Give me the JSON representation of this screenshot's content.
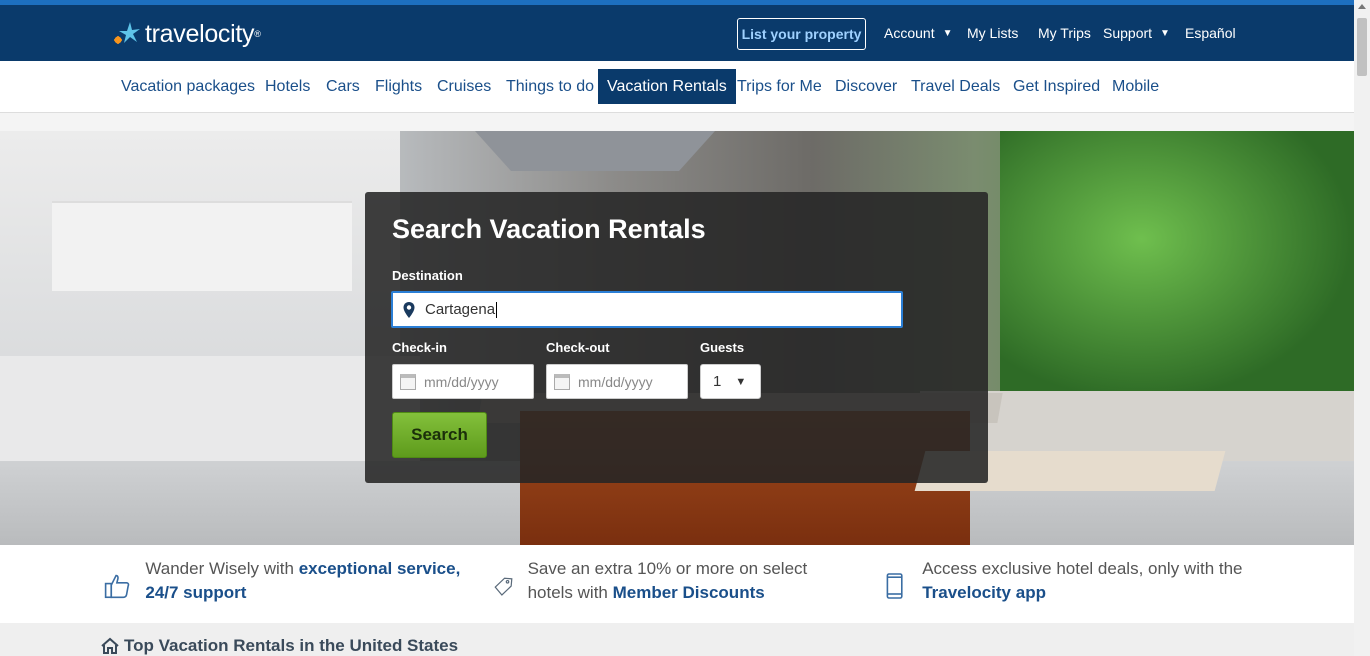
{
  "brand": {
    "name": "travelocity",
    "tm": "®"
  },
  "header": {
    "list_property": "List your property",
    "links": [
      "Account",
      "My Lists",
      "My Trips",
      "Support",
      "Español"
    ]
  },
  "nav": {
    "items": [
      "Vacation packages",
      "Hotels",
      "Cars",
      "Flights",
      "Cruises",
      "Things to do",
      "Vacation Rentals",
      "Trips for Me",
      "Discover",
      "Travel Deals",
      "Get Inspired",
      "Mobile"
    ],
    "active": "Vacation Rentals"
  },
  "search": {
    "title": "Search Vacation Rentals",
    "destination_label": "Destination",
    "destination_value": "Cartagena",
    "checkin_label": "Check-in",
    "checkin_placeholder": "mm/dd/yyyy",
    "checkout_label": "Check-out",
    "checkout_placeholder": "mm/dd/yyyy",
    "guests_label": "Guests",
    "guests_value": "1",
    "button": "Search"
  },
  "benefits": [
    {
      "icon": "thumbs-up-icon",
      "text": "Wander Wisely with ",
      "bold": "exceptional service, 24/7 support"
    },
    {
      "icon": "tag-icon",
      "text": "Save an extra 10% or more on select hotels with ",
      "bold": "Member Discounts"
    },
    {
      "icon": "phone-icon",
      "text": "Access exclusive hotel deals, only with the ",
      "bold": "Travelocity app"
    }
  ],
  "section": {
    "title": "Top Vacation Rentals in the United States",
    "icon": "home-icon"
  },
  "colors": {
    "header": "#0a3a6b",
    "accent": "#2b7fd6",
    "search_button": "#6aab28"
  }
}
